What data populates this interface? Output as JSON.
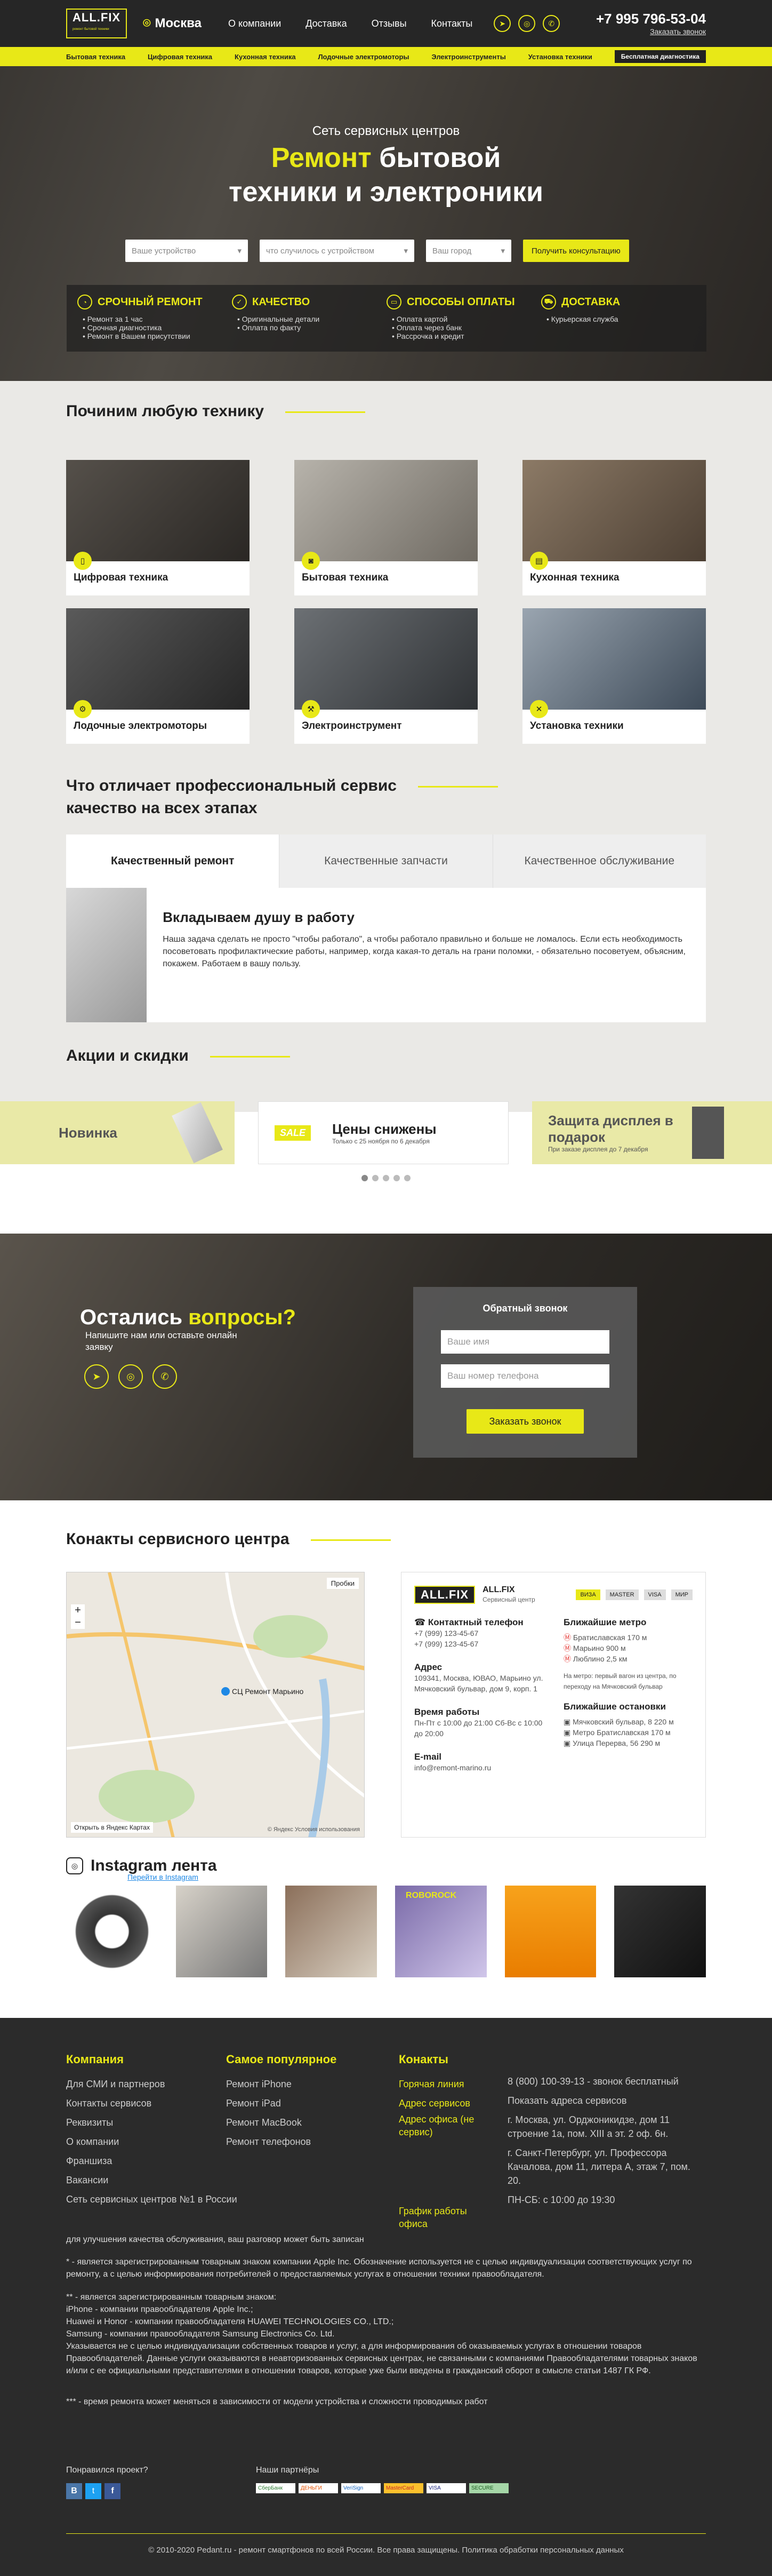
{
  "header": {
    "logo": "ALL.FIX",
    "logo_sub": "ремонт бытовой техники",
    "city": "Москва",
    "nav": [
      "О компании",
      "Доставка",
      "Отзывы",
      "Контакты"
    ],
    "phone": "+7 995 796-53-04",
    "callback": "Заказать звонок"
  },
  "catbar": [
    "Бытовая техника",
    "Цифровая техника",
    "Кухонная техника",
    "Лодочные электромоторы",
    "Электроинструменты",
    "Установка техники"
  ],
  "catbar_diag": "Бесплатная диагностика",
  "hero": {
    "sub": "Сеть сервисных центров",
    "title_y": "Ремонт",
    "title_w1": " бытовой",
    "title_w2": "техники и электроники",
    "in1": "Ваше устройство",
    "in2": "что случилось с устройством",
    "in3": "Ваш город",
    "btn": "Получить консультацию"
  },
  "features": [
    {
      "t": "СРОЧНЫЙ РЕМОНТ",
      "i": [
        "Ремонт за 1 час",
        "Срочная диагностика",
        "Ремонт в Вашем присутствии"
      ]
    },
    {
      "t": "КАЧЕСТВО",
      "i": [
        "Оригинальные детали",
        "Оплата по факту"
      ]
    },
    {
      "t": "СПОСОБЫ ОПЛАТЫ",
      "i": [
        "Оплата картой",
        "Оплата через банк",
        "Рассрочка и кредит"
      ]
    },
    {
      "t": "ДОСТАВКА",
      "i": [
        "Курьерская служба"
      ]
    }
  ],
  "fix": {
    "title": "Починим любую технику",
    "tiles": [
      "Цифровая техника",
      "Бытовая техника",
      "Кухонная техника",
      "Лодочные электромоторы",
      "Электроинструмент",
      "Установка техники"
    ]
  },
  "diff": {
    "title1": "Что отличает профессиональный сервис",
    "title2": "качество на всех этапах",
    "tabs": [
      "Качественный ремонт",
      "Качественные запчасти",
      "Качественное обслуживание"
    ],
    "h": "Вкладываем душу в работу",
    "p": "Наша задача сделать не просто \"чтобы работало\", а чтобы работало правильно и больше не ломалось. Если есть необходимость посоветовать профилактические работы, например, когда какая-то деталь на грани поломки, - обязательно посоветуем, объясним, покажем. Работаем в вашу пользу."
  },
  "promo": {
    "title": "Акции и скидки",
    "p1": "Новинка",
    "p2": "Цены снижены",
    "p2s": "Только с 25 ноября по 6 декабря",
    "p3": "Защита дисплея в подарок",
    "p3s": "При заказе дисплея до 7 декабря",
    "sale": "SALE"
  },
  "cb": {
    "t1": "Остались",
    "t2": "вопросы?",
    "p": "Напишите нам или оставьте онлайн заявку",
    "ftitle": "Обратный звонок",
    "f1": "Ваше имя",
    "f2": "Ваш номер телефона",
    "btn": "Заказать звонок"
  },
  "contacts": {
    "title": "Конакты сервисного центра",
    "map_pin": "СЦ Ремонт Марьино",
    "map_traffic": "Пробки",
    "map_open": "Открыть в Яндекс Картах",
    "map_copy": "© Яндекс Условия использования",
    "logo": "ALL.FIX",
    "logo_sub": "Сервисный центр",
    "pay": [
      "ВИЗА",
      "MASTER",
      "VISA",
      "МИР"
    ],
    "tel_l": "Контактный телефон",
    "tel1": "+7 (999) 123-45-67",
    "tel2": "+7 (999) 123-45-67",
    "addr_l": "Адрес",
    "addr": "109341, Москва, ЮВАО, Марьино ул. Мячковский бульвар, дом 9, корп. 1",
    "time_l": "Время работы",
    "time": "Пн-Пт с 10:00 до 21:00 Сб-Вс с 10:00 до 20:00",
    "mail_l": "E-mail",
    "mail": "info@remont-marino.ru",
    "metro_l": "Ближайшие метро",
    "metro": [
      "Братиславская 170 м",
      "Марьино 900 м",
      "Люблино 2,5 км"
    ],
    "metro_note": "На метро: первый вагон из центра, по переходу на Мячковский бульвар",
    "stop_l": "Ближайшие остановки",
    "stops": [
      "Мячковский бульвар, 8 220 м",
      "Метро Братиславская 170 м",
      "Улица Перерва, 56 290 м"
    ]
  },
  "insta": {
    "title": "Instagram лента",
    "link": "Перейти в Instagram",
    "tag": "ROBOROCK"
  },
  "footer": {
    "c1h": "Компания",
    "c1": [
      "Для СМИ и партнеров",
      "Контакты сервисов",
      "Реквизиты",
      "О компании",
      "Франшиза",
      "Вакансии",
      "Сеть сервисных центров №1 в России"
    ],
    "c2h": "Самое популярное",
    "c2": [
      "Ремонт iPhone",
      "Ремонт iPad",
      "Ремонт MacBook",
      "Ремонт телефонов"
    ],
    "c3h": "Конакты",
    "c3": [
      "Горячая линия",
      "Адрес сервисов",
      "Адрес офиса (не сервис)",
      "",
      "",
      "График работы офиса"
    ],
    "c4": [
      "8 (800) 100-39-13 - звонок бесплатный",
      "Показать адреса сервисов",
      "г. Москва, ул. Орджоникидзе, дом 11 строение 1а, пом. XIII а эт. 2 оф. 6н.",
      "г. Санкт-Петербург, ул. Профессора Качалова, дом 11, литера А, этаж 7, пом. 20.",
      "ПН-СБ: с 10:00 до 19:30"
    ],
    "n0": "для улучшения качества обслуживания, ваш разговор может быть записан",
    "n1": "* - является зарегистрированным товарным знаком компании Apple Inc. Обозначение используется не с целью индивидуализации соответствующих услуг по ремонту, а с целью информирования потребителей о предоставляемых услугах в отношении техники правообладателя.",
    "n2": "** - является зарегистрированным товарным знаком:\niPhone - компании правообладателя Apple Inc.;\nHuawei и Honor - компании правообладателя HUAWEI TECHNOLOGIES CO., LTD.;\nSamsung - компании правообладателя Samsung Electronics Co. Ltd.\nУказывается не с целью индивидуализации собственных товаров и услуг, а для информирования об оказываемых услугах в отношении товаров Правообладателей. Данные услуги оказываются в неавторизованных сервисных центрах, не связанными с компаниями Правообладателями товарных знаков и/или с ее официальными представителями в отношении товаров, которые уже были введены в гражданский оборот в смысле статьи 1487 ГК РФ.",
    "n3": "*** - время ремонта может меняться в зависимости от модели устройства и сложности проводимых работ",
    "like": "Понравился проект?",
    "partners": "Наши партнёры",
    "partner_logos": [
      "СберБанк",
      "ДЕНЬГИ",
      "VeriSign",
      "MasterCard",
      "VISA",
      "SECURE"
    ],
    "copy": "© 2010-2020 Pedant.ru - ремонт смартфонов по всей России. Все права защищены. Политика обработки персональных данных"
  }
}
